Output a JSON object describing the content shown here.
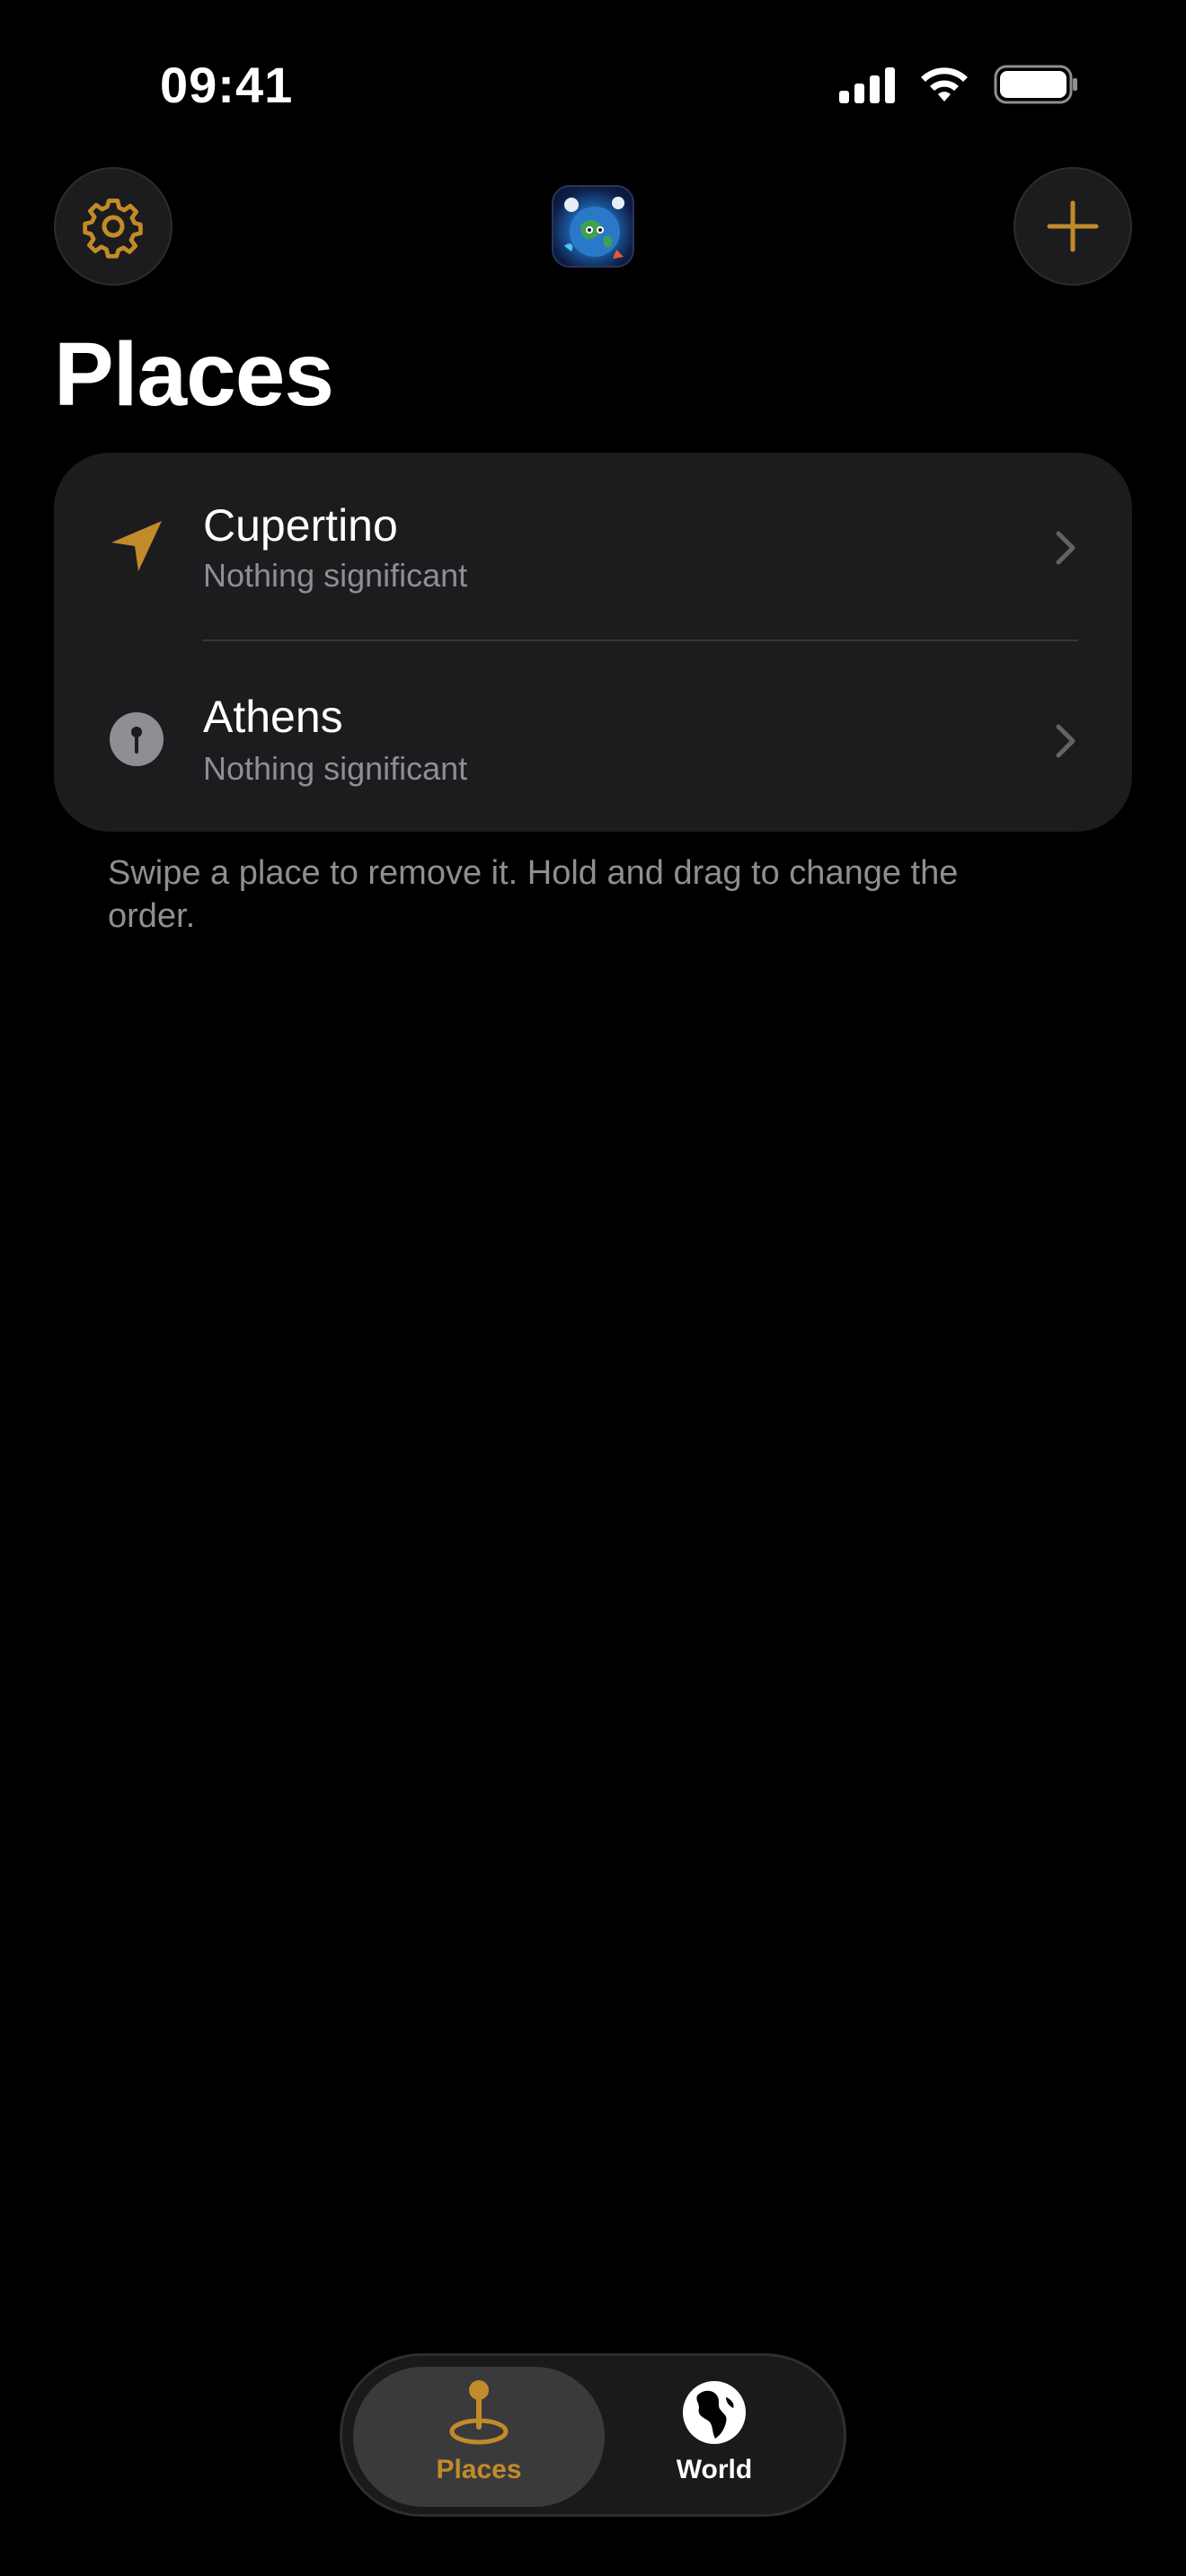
{
  "status_bar": {
    "time": "09:41",
    "icons": [
      "cellular-signal-icon",
      "wifi-icon",
      "battery-icon"
    ]
  },
  "header": {
    "settings_icon": "gear-icon",
    "add_icon": "plus-icon",
    "app_icon": "earth-app-icon"
  },
  "page": {
    "title": "Places"
  },
  "places": [
    {
      "name": "Cupertino",
      "status": "Nothing significant",
      "icon": "location-arrow-icon"
    },
    {
      "name": "Athens",
      "status": "Nothing significant",
      "icon": "pin-icon"
    }
  ],
  "footnote": "Swipe a place to remove it. Hold and drag to change the order.",
  "tabbar": {
    "tabs": [
      {
        "label": "Places",
        "icon": "map-pin-icon",
        "selected": true
      },
      {
        "label": "World",
        "icon": "globe-icon",
        "selected": false
      }
    ]
  },
  "colors": {
    "accent": "#c28b2a",
    "background": "#000000",
    "card": "#1c1c1e",
    "secondary_text": "#8e8e93"
  }
}
